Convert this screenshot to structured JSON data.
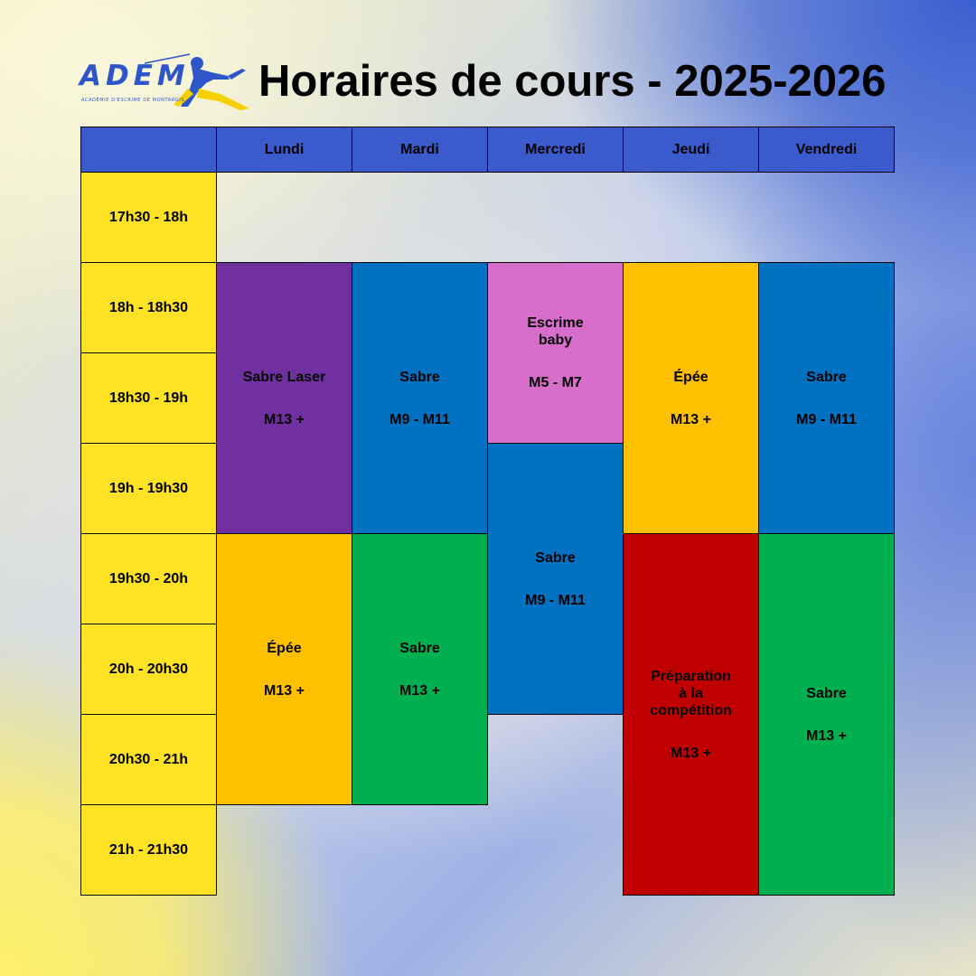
{
  "logo": {
    "text": "ADEM",
    "subtitle": "ACADÉMIE D'ESCRIME DE MONTARGIS"
  },
  "title": "Horaires de cours - 2025-2026",
  "days": [
    "Lundi",
    "Mardi",
    "Mercredi",
    "Jeudi",
    "Vendredi"
  ],
  "time_slots": [
    "17h30 - 18h",
    "18h - 18h30",
    "18h30 - 19h",
    "19h - 19h30",
    "19h30 - 20h",
    "20h - 20h30",
    "20h30 - 21h",
    "21h - 21h30"
  ],
  "colors": {
    "header": "#3b5bcc",
    "time": "#ffe225",
    "purple": "#7030a0",
    "blue": "#0070c0",
    "pink": "#d86ecc",
    "orange": "#ffc000",
    "green": "#00b050",
    "red": "#c00000"
  },
  "courses": [
    {
      "day": "Lundi",
      "start": "18h",
      "end": "19h30",
      "name": "Sabre Laser",
      "level": "M13 +",
      "color": "#7030a0"
    },
    {
      "day": "Lundi",
      "start": "19h30",
      "end": "21h",
      "name": "Épée",
      "level": "M13 +",
      "color": "#ffc000"
    },
    {
      "day": "Mardi",
      "start": "18h",
      "end": "19h30",
      "name": "Sabre",
      "level": "M9 - M11",
      "color": "#0070c0"
    },
    {
      "day": "Mardi",
      "start": "19h30",
      "end": "21h",
      "name": "Sabre",
      "level": "M13 +",
      "color": "#00b050"
    },
    {
      "day": "Mercredi",
      "start": "18h",
      "end": "19h",
      "name": "Escrime\nbaby",
      "level": "M5 - M7",
      "color": "#d86ecc"
    },
    {
      "day": "Mercredi",
      "start": "19h",
      "end": "20h30",
      "name": "Sabre",
      "level": "M9 - M11",
      "color": "#0070c0"
    },
    {
      "day": "Jeudi",
      "start": "18h",
      "end": "19h30",
      "name": "Épée",
      "level": "M13 +",
      "color": "#ffc000"
    },
    {
      "day": "Jeudi",
      "start": "19h30",
      "end": "21h30",
      "name": "Préparation\nà la\ncompétition",
      "level": "M13 +",
      "color": "#c00000"
    },
    {
      "day": "Vendredi",
      "start": "18h",
      "end": "19h30",
      "name": "Sabre",
      "level": "M9 - M11",
      "color": "#0070c0"
    },
    {
      "day": "Vendredi",
      "start": "19h30",
      "end": "21h30",
      "name": "Sabre",
      "level": "M13 +",
      "color": "#00b050"
    }
  ]
}
